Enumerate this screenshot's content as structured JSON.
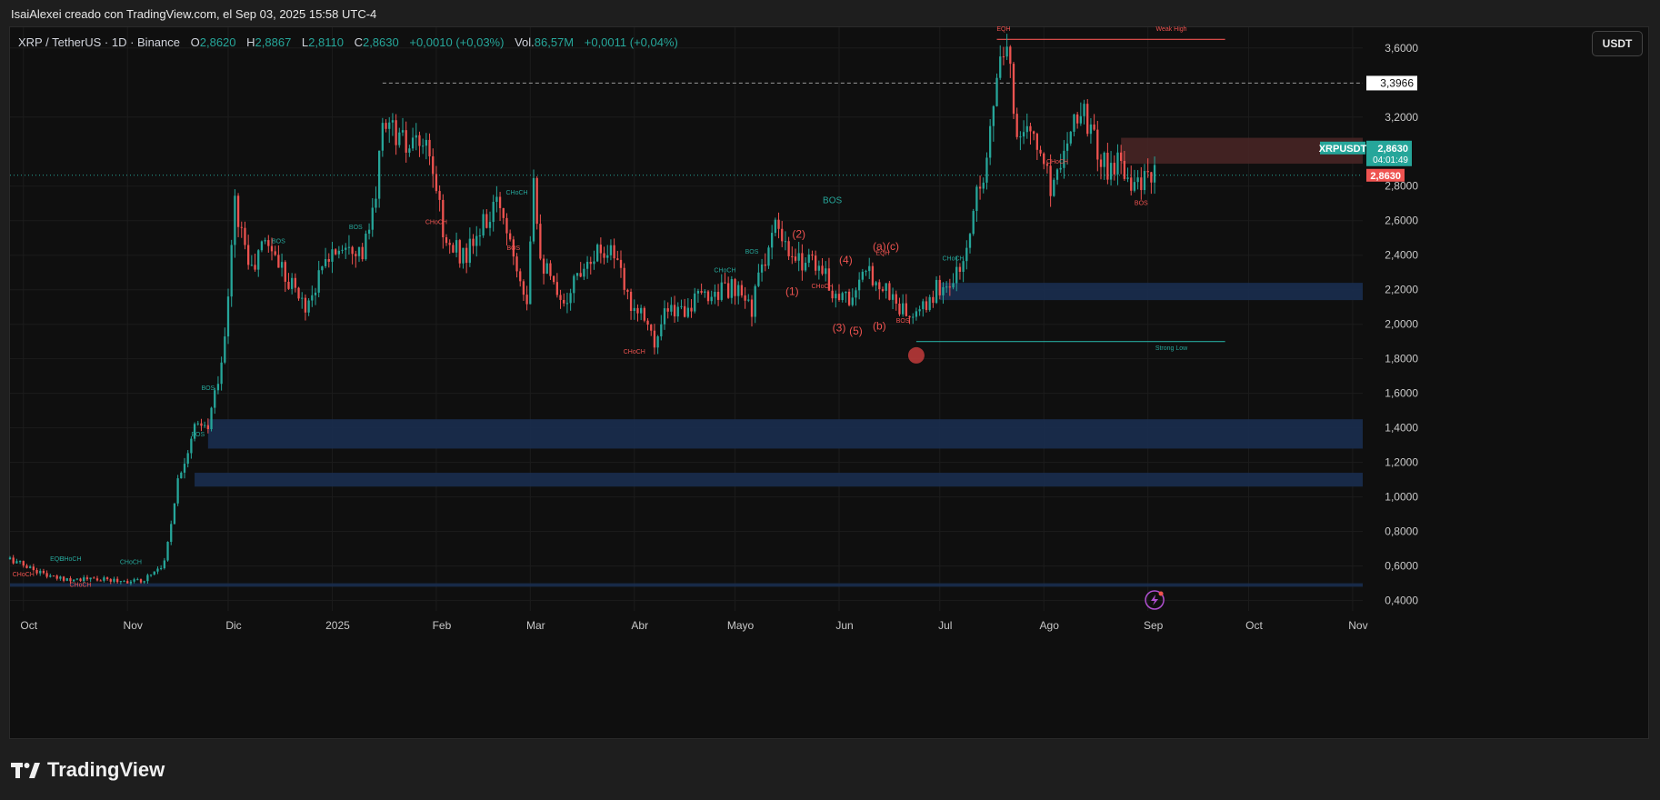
{
  "header": {
    "caption": "IsaiAlexei creado con TradingView.com, el Sep 03, 2025 15:58 UTC-4"
  },
  "legend": {
    "symbol": "XRP / TetherUS · 1D · Binance",
    "open_label": "O",
    "open": "2,8620",
    "high_label": "H",
    "high": "2,8867",
    "low_label": "L",
    "low": "2,8110",
    "close_label": "C",
    "close": "2,8630",
    "change": "+0,0010 (+0,03%)",
    "vol_label": "Vol.",
    "volume": "86,57M",
    "vol_change": "+0,0011 (+0,04%)"
  },
  "currency_button": "USDT",
  "brand": "TradingView",
  "colors": {
    "up": "#26a69a",
    "down": "#ef5350",
    "zone": "#1a2d4f",
    "supply": "#4a2626",
    "background": "#0f0f0f"
  },
  "chart_data": {
    "type": "candlestick",
    "symbol": "XRPUSDT",
    "timeframe": "1D",
    "ylim": [
      0.34,
      3.72
    ],
    "y_ticks": [
      "3,6000",
      "3,2000",
      "2,8000",
      "2,6000",
      "2,4000",
      "2,2000",
      "2,0000",
      "1,8000",
      "1,6000",
      "1,4000",
      "1,2000",
      "1,0000",
      "0,8000",
      "0,6000",
      "0,4000"
    ],
    "y_tick_values": [
      3.6,
      3.2,
      2.8,
      2.6,
      2.4,
      2.2,
      2.0,
      1.8,
      1.6,
      1.4,
      1.2,
      1.0,
      0.8,
      0.6,
      0.4
    ],
    "x_ticks": [
      {
        "label": "Oct",
        "date": "2024-10-01"
      },
      {
        "label": "Nov",
        "date": "2024-11-01"
      },
      {
        "label": "Dic",
        "date": "2024-12-01"
      },
      {
        "label": "2025",
        "date": "2025-01-01"
      },
      {
        "label": "Feb",
        "date": "2025-02-01"
      },
      {
        "label": "Mar",
        "date": "2025-03-01"
      },
      {
        "label": "Abr",
        "date": "2025-04-01"
      },
      {
        "label": "Mayo",
        "date": "2025-05-01"
      },
      {
        "label": "Jun",
        "date": "2025-06-01"
      },
      {
        "label": "Jul",
        "date": "2025-07-01"
      },
      {
        "label": "Ago",
        "date": "2025-08-01"
      },
      {
        "label": "Sep",
        "date": "2025-09-01"
      },
      {
        "label": "Oct",
        "date": "2025-10-01"
      },
      {
        "label": "Nov",
        "date": "2025-11-01"
      }
    ],
    "x_range": [
      "2024-09-27",
      "2025-11-04"
    ],
    "close_path": [
      [
        "2024-09-27",
        0.64
      ],
      [
        "2024-10-10",
        0.53
      ],
      [
        "2024-10-25",
        0.52
      ],
      [
        "2024-11-05",
        0.51
      ],
      [
        "2024-11-12",
        0.62
      ],
      [
        "2024-11-16",
        1.1
      ],
      [
        "2024-11-21",
        1.4
      ],
      [
        "2024-11-25",
        1.4
      ],
      [
        "2024-11-30",
        1.9
      ],
      [
        "2024-12-03",
        2.7
      ],
      [
        "2024-12-08",
        2.3
      ],
      [
        "2024-12-12",
        2.5
      ],
      [
        "2024-12-18",
        2.3
      ],
      [
        "2024-12-24",
        2.1
      ],
      [
        "2024-12-31",
        2.4
      ],
      [
        "2025-01-06",
        2.5
      ],
      [
        "2025-01-10",
        2.4
      ],
      [
        "2025-01-14",
        2.7
      ],
      [
        "2025-01-16",
        3.2
      ],
      [
        "2025-01-20",
        3.1
      ],
      [
        "2025-01-24",
        3.0
      ],
      [
        "2025-01-28",
        3.05
      ],
      [
        "2025-02-01",
        2.8
      ],
      [
        "2025-02-04",
        2.45
      ],
      [
        "2025-02-10",
        2.4
      ],
      [
        "2025-02-16",
        2.6
      ],
      [
        "2025-02-20",
        2.7
      ],
      [
        "2025-02-26",
        2.3
      ],
      [
        "2025-02-28",
        2.15
      ],
      [
        "2025-03-02",
        2.9
      ],
      [
        "2025-03-04",
        2.4
      ],
      [
        "2025-03-10",
        2.1
      ],
      [
        "2025-03-18",
        2.4
      ],
      [
        "2025-03-25",
        2.45
      ],
      [
        "2025-03-30",
        2.15
      ],
      [
        "2025-04-05",
        2.05
      ],
      [
        "2025-04-07",
        1.85
      ],
      [
        "2025-04-10",
        2.05
      ],
      [
        "2025-04-16",
        2.1
      ],
      [
        "2025-04-26",
        2.2
      ],
      [
        "2025-04-30",
        2.2
      ],
      [
        "2025-05-06",
        2.1
      ],
      [
        "2025-05-10",
        2.4
      ],
      [
        "2025-05-13",
        2.55
      ],
      [
        "2025-05-18",
        2.35
      ],
      [
        "2025-05-24",
        2.4
      ],
      [
        "2025-05-30",
        2.2
      ],
      [
        "2025-06-04",
        2.15
      ],
      [
        "2025-06-10",
        2.3
      ],
      [
        "2025-06-15",
        2.2
      ],
      [
        "2025-06-21",
        2.05
      ],
      [
        "2025-06-25",
        2.05
      ],
      [
        "2025-06-30",
        2.2
      ],
      [
        "2025-07-05",
        2.25
      ],
      [
        "2025-07-09",
        2.4
      ],
      [
        "2025-07-12",
        2.8
      ],
      [
        "2025-07-15",
        2.95
      ],
      [
        "2025-07-18",
        3.45
      ],
      [
        "2025-07-21",
        3.55
      ],
      [
        "2025-07-24",
        3.15
      ],
      [
        "2025-07-28",
        3.1
      ],
      [
        "2025-08-01",
        2.95
      ],
      [
        "2025-08-03",
        2.8
      ],
      [
        "2025-08-07",
        3.0
      ],
      [
        "2025-08-09",
        3.2
      ],
      [
        "2025-08-13",
        3.25
      ],
      [
        "2025-08-16",
        3.05
      ],
      [
        "2025-08-20",
        2.9
      ],
      [
        "2025-08-24",
        2.95
      ],
      [
        "2025-08-27",
        2.85
      ],
      [
        "2025-08-30",
        2.8
      ],
      [
        "2025-09-03",
        2.863
      ]
    ],
    "price_lines": [
      {
        "label": "3,3966",
        "value": 3.3966,
        "style": "dashed-white"
      },
      {
        "label": "2,8630",
        "value": 2.863,
        "style": "dotted-teal"
      }
    ],
    "price_badges": {
      "symbol": "XRPUSDT",
      "price": "2,8630",
      "countdown": "04:01:49",
      "close_label": "2,8630"
    },
    "zones": [
      {
        "name": "demand",
        "from": 2.14,
        "to": 2.24,
        "start": "2025-07-01"
      },
      {
        "name": "demand",
        "from": 1.28,
        "to": 1.45,
        "start": "2024-11-25"
      },
      {
        "name": "demand",
        "from": 1.06,
        "to": 1.14,
        "start": "2024-11-21"
      },
      {
        "name": "demand",
        "from": 0.48,
        "to": 0.5,
        "start": "2024-09-27"
      },
      {
        "name": "supply",
        "from": 2.93,
        "to": 3.08,
        "start": "2025-08-24"
      }
    ],
    "levels": [
      {
        "label": "Weak High",
        "value": 3.65,
        "start": "2025-07-18",
        "end": "2025-09-24",
        "color": "#ef5350"
      },
      {
        "label": "Strong Low",
        "value": 1.9,
        "start": "2025-06-24",
        "end": "2025-09-24",
        "color": "#26a69a"
      }
    ],
    "annotations": [
      {
        "text": "BOS",
        "date": "2025-05-30",
        "value": 2.7,
        "color": "#26a69a",
        "size": "medium"
      },
      {
        "text": "EQH",
        "date": "2025-07-20",
        "value": 3.7,
        "color": "#ef5350"
      },
      {
        "text": "Weak High",
        "date": "2025-09-08",
        "value": 3.7,
        "color": "#ef5350"
      },
      {
        "text": "Strong Low",
        "date": "2025-09-08",
        "value": 1.85,
        "color": "#26a69a"
      },
      {
        "text": "(2)",
        "date": "2025-05-20",
        "value": 2.5,
        "color": "#ef5350",
        "size": "wave"
      },
      {
        "text": "(1)",
        "date": "2025-05-18",
        "value": 2.17,
        "color": "#ef5350",
        "size": "wave"
      },
      {
        "text": "(4)",
        "date": "2025-06-03",
        "value": 2.35,
        "color": "#ef5350",
        "size": "wave"
      },
      {
        "text": "(3)",
        "date": "2025-06-01",
        "value": 1.96,
        "color": "#ef5350",
        "size": "wave"
      },
      {
        "text": "(5)",
        "date": "2025-06-06",
        "value": 1.94,
        "color": "#ef5350",
        "size": "wave"
      },
      {
        "text": "(a)",
        "date": "2025-06-13",
        "value": 2.43,
        "color": "#ef5350",
        "size": "wave"
      },
      {
        "text": "(c)",
        "date": "2025-06-17",
        "value": 2.43,
        "color": "#ef5350",
        "size": "wave"
      },
      {
        "text": "(b)",
        "date": "2025-06-13",
        "value": 1.97,
        "color": "#ef5350",
        "size": "wave"
      },
      {
        "text": "EQH",
        "date": "2025-06-14",
        "value": 2.4,
        "color": "#ef5350"
      },
      {
        "text": "CHoCH",
        "date": "2025-05-27",
        "value": 2.21,
        "color": "#ef5350"
      },
      {
        "text": "BOS",
        "date": "2025-06-20",
        "value": 2.01,
        "color": "#ef5350"
      },
      {
        "text": "CHoCH",
        "date": "2025-07-05",
        "value": 2.37,
        "color": "#26a69a"
      },
      {
        "text": "BOS",
        "date": "2025-05-06",
        "value": 2.41,
        "color": "#26a69a"
      },
      {
        "text": "CHoCH",
        "date": "2025-04-28",
        "value": 2.3,
        "color": "#26a69a"
      },
      {
        "text": "CHoCH",
        "date": "2025-02-25",
        "value": 2.75,
        "color": "#26a69a"
      },
      {
        "text": "BOS",
        "date": "2025-02-24",
        "value": 2.43,
        "color": "#ef5350"
      },
      {
        "text": "CHoCH",
        "date": "2025-02-01",
        "value": 2.58,
        "color": "#ef5350"
      },
      {
        "text": "CHoCH",
        "date": "2025-04-01",
        "value": 1.83,
        "color": "#ef5350"
      },
      {
        "text": "BOS",
        "date": "2025-01-08",
        "value": 2.55,
        "color": "#26a69a"
      },
      {
        "text": "BOS",
        "date": "2024-12-16",
        "value": 2.47,
        "color": "#26a69a"
      },
      {
        "text": "BOS",
        "date": "2024-11-25",
        "value": 1.62,
        "color": "#26a69a"
      },
      {
        "text": "BOS",
        "date": "2024-11-22",
        "value": 1.35,
        "color": "#26a69a"
      },
      {
        "text": "CHoCH",
        "date": "2025-08-05",
        "value": 2.93,
        "color": "#ef5350"
      },
      {
        "text": "BOS",
        "date": "2025-08-30",
        "value": 2.69,
        "color": "#ef5350"
      },
      {
        "text": "EQH",
        "date": "2024-10-11",
        "value": 0.63,
        "color": "#26a69a"
      },
      {
        "text": "CHoCH",
        "date": "2024-10-15",
        "value": 0.63,
        "color": "#26a69a"
      },
      {
        "text": "CHoCH",
        "date": "2024-11-02",
        "value": 0.61,
        "color": "#26a69a"
      },
      {
        "text": "CHoCH",
        "date": "2024-10-01",
        "value": 0.54,
        "color": "#ef5350"
      },
      {
        "text": "CHoCH",
        "date": "2024-10-18",
        "value": 0.48,
        "color": "#ef5350"
      }
    ],
    "marker": {
      "date": "2025-06-24",
      "value": 1.82
    },
    "grid": true,
    "legend": "top-left"
  }
}
